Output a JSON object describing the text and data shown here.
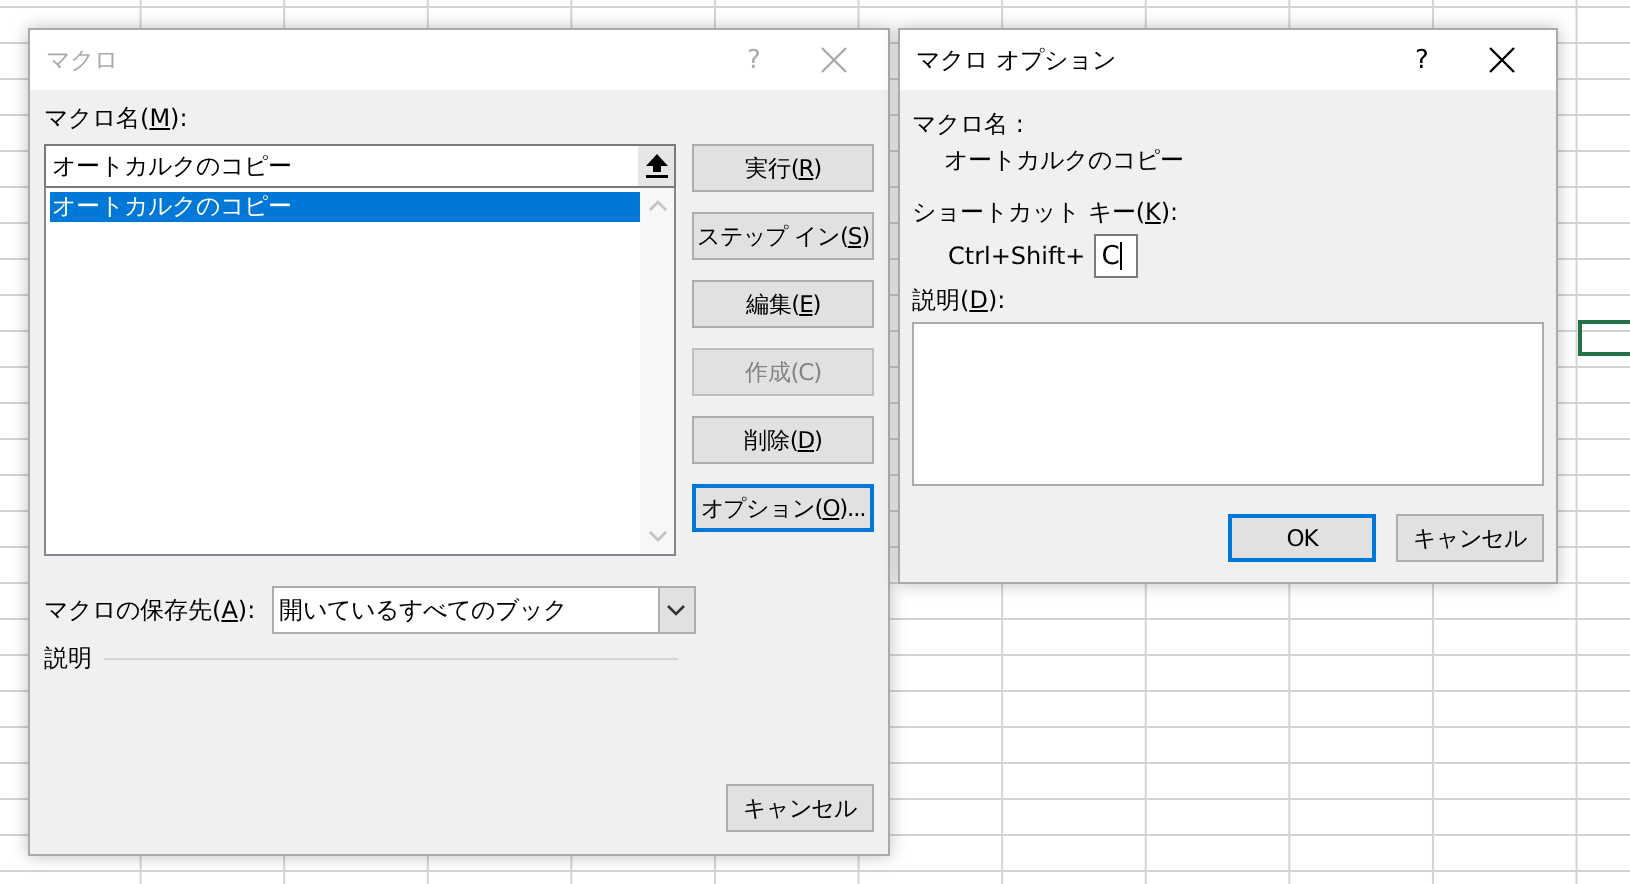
{
  "macro_dialog": {
    "title": "マクロ",
    "active": false,
    "help": "?",
    "name_label": {
      "before": "マクロ名(",
      "key": "M",
      "after": "):"
    },
    "name_value": "オートカルクのコピー",
    "macros": [
      {
        "label": "オートカルクのコピー",
        "selected": true
      }
    ],
    "buttons": [
      {
        "before": "実行(",
        "key": "R",
        "after": ")",
        "disabled": false,
        "focused": false
      },
      {
        "before": "ステップ イン(",
        "key": "S",
        "after": ")",
        "disabled": false,
        "focused": false
      },
      {
        "before": "編集(",
        "key": "E",
        "after": ")",
        "disabled": false,
        "focused": false
      },
      {
        "before": "作成(C)",
        "disabled": true,
        "focused": false
      },
      {
        "before": "削除(",
        "key": "D",
        "after": ")",
        "disabled": false,
        "focused": false
      },
      {
        "before": "オプション(",
        "key": "O",
        "after": ")...",
        "disabled": false,
        "focused": true
      }
    ],
    "store_label": {
      "before": "マクロの保存先(",
      "key": "A",
      "after": "):"
    },
    "store_value": "開いているすべてのブック",
    "description_label": "説明",
    "cancel": "キャンセル"
  },
  "options_dialog": {
    "title": "マクロ オプション",
    "active": true,
    "help": "?",
    "name_label": "マクロ名 :",
    "name_value": "オートカルクのコピー",
    "shortcut_label": {
      "before": "ショートカット キー(",
      "key": "K",
      "after": "):"
    },
    "shortcut_prefix": "Ctrl+Shift+",
    "shortcut_value": "C",
    "description_label": {
      "before": "説明(",
      "key": "D",
      "after": "):"
    },
    "buttons": [
      {
        "before": "OK",
        "focused": true
      },
      {
        "before": "キャンセル",
        "focused": false
      }
    ]
  }
}
